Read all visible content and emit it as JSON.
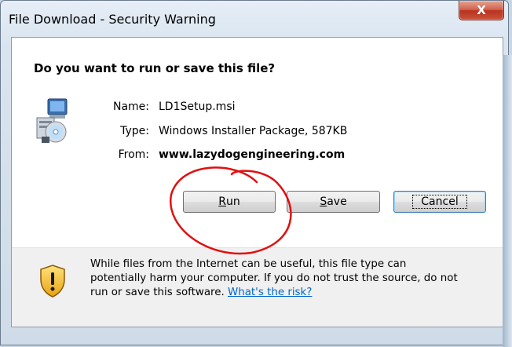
{
  "window": {
    "title": "File Download - Security Warning",
    "close_label": "X"
  },
  "question": "Do you want to run or save this file?",
  "file_icon": "installer-package-icon",
  "file_info": {
    "name_label": "Name:",
    "name_value": "LD1Setup.msi",
    "type_label": "Type:",
    "type_value": "Windows Installer Package, 587KB",
    "from_label": "From:",
    "from_value": "www.lazydogengineering.com"
  },
  "buttons": {
    "run": {
      "accel": "R",
      "rest": "un"
    },
    "save": {
      "accel": "S",
      "rest": "ave"
    },
    "cancel": "Cancel"
  },
  "warning": {
    "icon": "security-shield-icon",
    "line1": "While files from the Internet can be useful, this file type can",
    "line2": "potentially harm your computer. If you do not trust the source, do not",
    "line3_before_link": "run or save this software. ",
    "link": "What's the risk?"
  },
  "colors": {
    "annotation": "#e01010",
    "link": "#0066cc",
    "close_button": "#c9523a"
  }
}
